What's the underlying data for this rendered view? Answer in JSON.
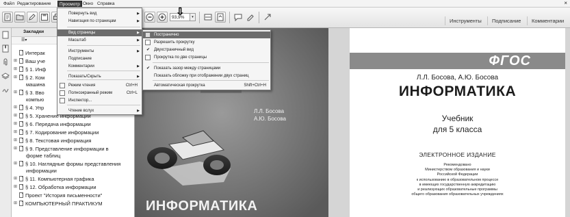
{
  "menubar": {
    "items": [
      "Файл",
      "Редактирование",
      "Просмотр",
      "Окно",
      "Справка"
    ],
    "close_glyph": "×"
  },
  "toolbar": {
    "zoom_value": "93,9%",
    "zoom_drop_glyph": "▾",
    "right_buttons": [
      "Инструменты",
      "Подписание",
      "Комментарии"
    ],
    "pointer_glyph": "⇩"
  },
  "panel": {
    "title": "Закладки",
    "options_glyph": "☰▾",
    "bookmarks": [
      {
        "expander": "",
        "text": "Интерак"
      },
      {
        "expander": "⊞",
        "text": "Ваш уче"
      },
      {
        "expander": "⊞",
        "text": "§ 1. Инф"
      },
      {
        "expander": "⊞",
        "text": "§ 2. Ком"
      },
      {
        "expander": "",
        "text": "машина"
      },
      {
        "expander": "⊞",
        "text": "§ 3. Вво"
      },
      {
        "expander": "",
        "text": "компью"
      },
      {
        "expander": "⊞",
        "text": "§ 4. Упр"
      },
      {
        "expander": "⊞",
        "text": "§ 5. Хранение информации"
      },
      {
        "expander": "⊞",
        "text": "§ 6. Передача информации"
      },
      {
        "expander": "⊞",
        "text": "§ 7. Кодирование информации"
      },
      {
        "expander": "⊞",
        "text": "§ 8. Текстовая информация"
      },
      {
        "expander": "⊞",
        "text": "§ 9. Представление информации в"
      },
      {
        "expander": "",
        "text": "форме таблиц"
      },
      {
        "expander": "⊞",
        "text": "§ 10. Наглядные формы представления"
      },
      {
        "expander": "",
        "text": "информации"
      },
      {
        "expander": "⊞",
        "text": "§ 11. Компьютерная графика"
      },
      {
        "expander": "⊞",
        "text": "§ 12. Обработка информации"
      },
      {
        "expander": "",
        "text": "Проект \"История письменности\""
      },
      {
        "expander": "⊞",
        "text": "КОМПЬЮТЕРНЫЙ ПРАКТИКУМ"
      }
    ]
  },
  "view_menu": {
    "items": [
      {
        "label": "Повернуть вид",
        "shortcut": "",
        "submenu": true
      },
      {
        "label": "Навигация по страницам",
        "shortcut": "",
        "submenu": true
      },
      {
        "label": "Вид страницы",
        "shortcut": "",
        "submenu": true,
        "highlighted": true
      },
      {
        "label": "Масштаб",
        "shortcut": "",
        "submenu": true
      },
      {
        "label": "Инструменты",
        "shortcut": "",
        "submenu": true
      },
      {
        "label": "Подписание",
        "shortcut": "",
        "submenu": false
      },
      {
        "label": "Комментарии",
        "shortcut": "",
        "submenu": true
      },
      {
        "label": "Показать/Скрыть",
        "shortcut": "",
        "submenu": true
      },
      {
        "label": "Режим чтения",
        "shortcut": "Ctrl+H",
        "submenu": false
      },
      {
        "label": "Полноэкранный режим",
        "shortcut": "Ctrl+L",
        "submenu": false
      },
      {
        "label": "Инспектор...",
        "shortcut": "",
        "submenu": false
      },
      {
        "label": "Чтение вслух",
        "shortcut": "",
        "submenu": true
      }
    ]
  },
  "page_display_submenu": {
    "items": [
      {
        "label": "Постранично",
        "shortcut": "",
        "checked": false,
        "highlighted": true
      },
      {
        "label": "Разрешить прокрутку",
        "shortcut": "",
        "checked": false
      },
      {
        "label": "Двухстраничный вид",
        "shortcut": "",
        "checked": true
      },
      {
        "label": "Прокрутка по две страницы",
        "shortcut": "",
        "checked": false
      },
      {
        "label": "Показать зазор между страницами",
        "shortcut": "",
        "checked": true
      },
      {
        "label": "Показать обложку при отображении двух страниц",
        "shortcut": "",
        "checked": false
      },
      {
        "label": "Автоматическая прокрутка",
        "shortcut": "Shift+Ctrl+H",
        "checked": false
      }
    ],
    "check_glyph": "✔"
  },
  "document": {
    "left_page": {
      "authors": [
        "Л.Л. Босова",
        "А.Ю. Босова"
      ],
      "title": "ИНФОРМАТИКА"
    },
    "right_page": {
      "fgos": "ФГОС",
      "authors": "Л.Л. Босова, А.Ю. Босова",
      "title": "ИНФОРМАТИКА",
      "subtitle1": "Учебник",
      "subtitle2": "для 5 класса",
      "edition": "ЭЛЕКТРОННОЕ ИЗДАНИЕ",
      "recommendation": [
        "Рекомендовано",
        "Министерством образования и науки",
        "Российской Федерации",
        "к использованию в образовательном процессе",
        "в имеющих государственную аккредитацию",
        "и реализующих образовательные программы",
        "общего образования образовательных учреждениях"
      ]
    }
  }
}
